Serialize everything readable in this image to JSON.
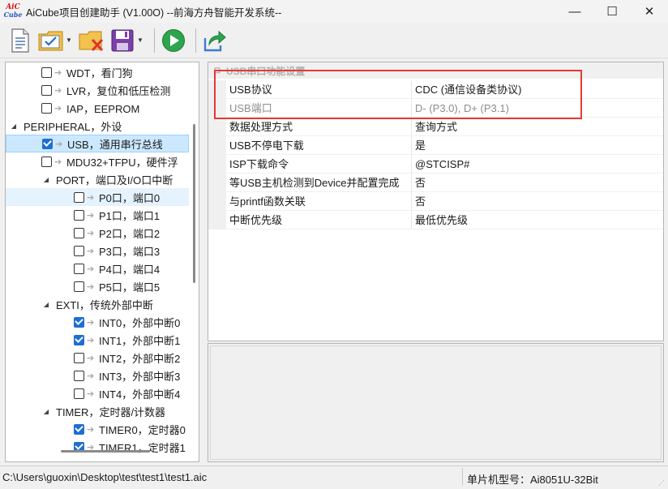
{
  "window": {
    "title": "AiCube项目创建助手 (V1.00O) --前海方舟智能开发系统--",
    "logo_line1": "AiC",
    "logo_line2": "Cube",
    "minimize_glyph": "—",
    "maximize_glyph": "☐",
    "close_glyph": "✕"
  },
  "toolbar": {
    "icons": [
      "new-document-icon",
      "project-settings-icon",
      "delete-folder-icon",
      "save-icon",
      "run-icon",
      "export-icon"
    ]
  },
  "tree": {
    "items": [
      {
        "label": "WDT，看门狗",
        "checked": false,
        "level": 1,
        "expander": "",
        "selected": false
      },
      {
        "label": "LVR，复位和低压检测",
        "checked": false,
        "level": 1,
        "expander": "",
        "selected": false
      },
      {
        "label": "IAP，EEPROM",
        "checked": false,
        "level": 1,
        "expander": "",
        "selected": false
      },
      {
        "label": "PERIPHERAL，外设",
        "checked": null,
        "level": 0,
        "expander": "◢",
        "selected": false
      },
      {
        "label": "USB，通用串行总线",
        "checked": true,
        "level": 1,
        "expander": "",
        "selected": true
      },
      {
        "label": "MDU32+TFPU，硬件浮",
        "checked": false,
        "level": 1,
        "expander": "",
        "selected": false
      },
      {
        "label": "PORT，端口及I/O口中断",
        "checked": null,
        "level": 1,
        "expander": "◢",
        "selected": false
      },
      {
        "label": "P0口，端口0",
        "checked": false,
        "level": 2,
        "expander": "",
        "selected": false,
        "hover": true
      },
      {
        "label": "P1口，端口1",
        "checked": false,
        "level": 2,
        "expander": "",
        "selected": false
      },
      {
        "label": "P2口，端口2",
        "checked": false,
        "level": 2,
        "expander": "",
        "selected": false
      },
      {
        "label": "P3口，端口3",
        "checked": false,
        "level": 2,
        "expander": "",
        "selected": false
      },
      {
        "label": "P4口，端口4",
        "checked": false,
        "level": 2,
        "expander": "",
        "selected": false
      },
      {
        "label": "P5口，端口5",
        "checked": false,
        "level": 2,
        "expander": "",
        "selected": false
      },
      {
        "label": "EXTI，传统外部中断",
        "checked": null,
        "level": 1,
        "expander": "◢",
        "selected": false
      },
      {
        "label": "INT0，外部中断0",
        "checked": true,
        "level": 2,
        "expander": "",
        "selected": false
      },
      {
        "label": "INT1，外部中断1",
        "checked": true,
        "level": 2,
        "expander": "",
        "selected": false
      },
      {
        "label": "INT2，外部中断2",
        "checked": false,
        "level": 2,
        "expander": "",
        "selected": false
      },
      {
        "label": "INT3，外部中断3",
        "checked": false,
        "level": 2,
        "expander": "",
        "selected": false
      },
      {
        "label": "INT4，外部中断4",
        "checked": false,
        "level": 2,
        "expander": "",
        "selected": false
      },
      {
        "label": "TIMER，定时器/计数器",
        "checked": null,
        "level": 1,
        "expander": "◢",
        "selected": false
      },
      {
        "label": "TIMER0，定时器0",
        "checked": true,
        "level": 2,
        "expander": "",
        "selected": false
      },
      {
        "label": "TIMER1，定时器1",
        "checked": true,
        "level": 2,
        "expander": "",
        "selected": false
      }
    ]
  },
  "properties": {
    "category": "USB串口功能设置",
    "rows": [
      {
        "name": "USB协议",
        "value": "CDC (通信设备类协议)",
        "grey": false
      },
      {
        "name": "USB端口",
        "value": "D- (P3.0), D+ (P3.1)",
        "grey": true
      },
      {
        "name": "数据处理方式",
        "value": "查询方式",
        "grey": false
      },
      {
        "name": "USB不停电下载",
        "value": "是",
        "grey": false
      },
      {
        "name": "ISP下载命令",
        "value": "@STCISP#",
        "grey": false
      },
      {
        "name": "等USB主机检测到Device并配置完成",
        "value": "否",
        "grey": false
      },
      {
        "name": "与printf函数关联",
        "value": "否",
        "grey": false
      },
      {
        "name": "中断优先级",
        "value": "最低优先级",
        "grey": false
      }
    ]
  },
  "status": {
    "path": "C:\\Users\\guoxin\\Desktop\\test\\test1\\test1.aic",
    "chip": "单片机型号：Ai8051U-32Bit"
  },
  "colors": {
    "highlight": "#e53935",
    "selection": "#cce8ff",
    "checkbox_checked": "#1f6fd1"
  }
}
